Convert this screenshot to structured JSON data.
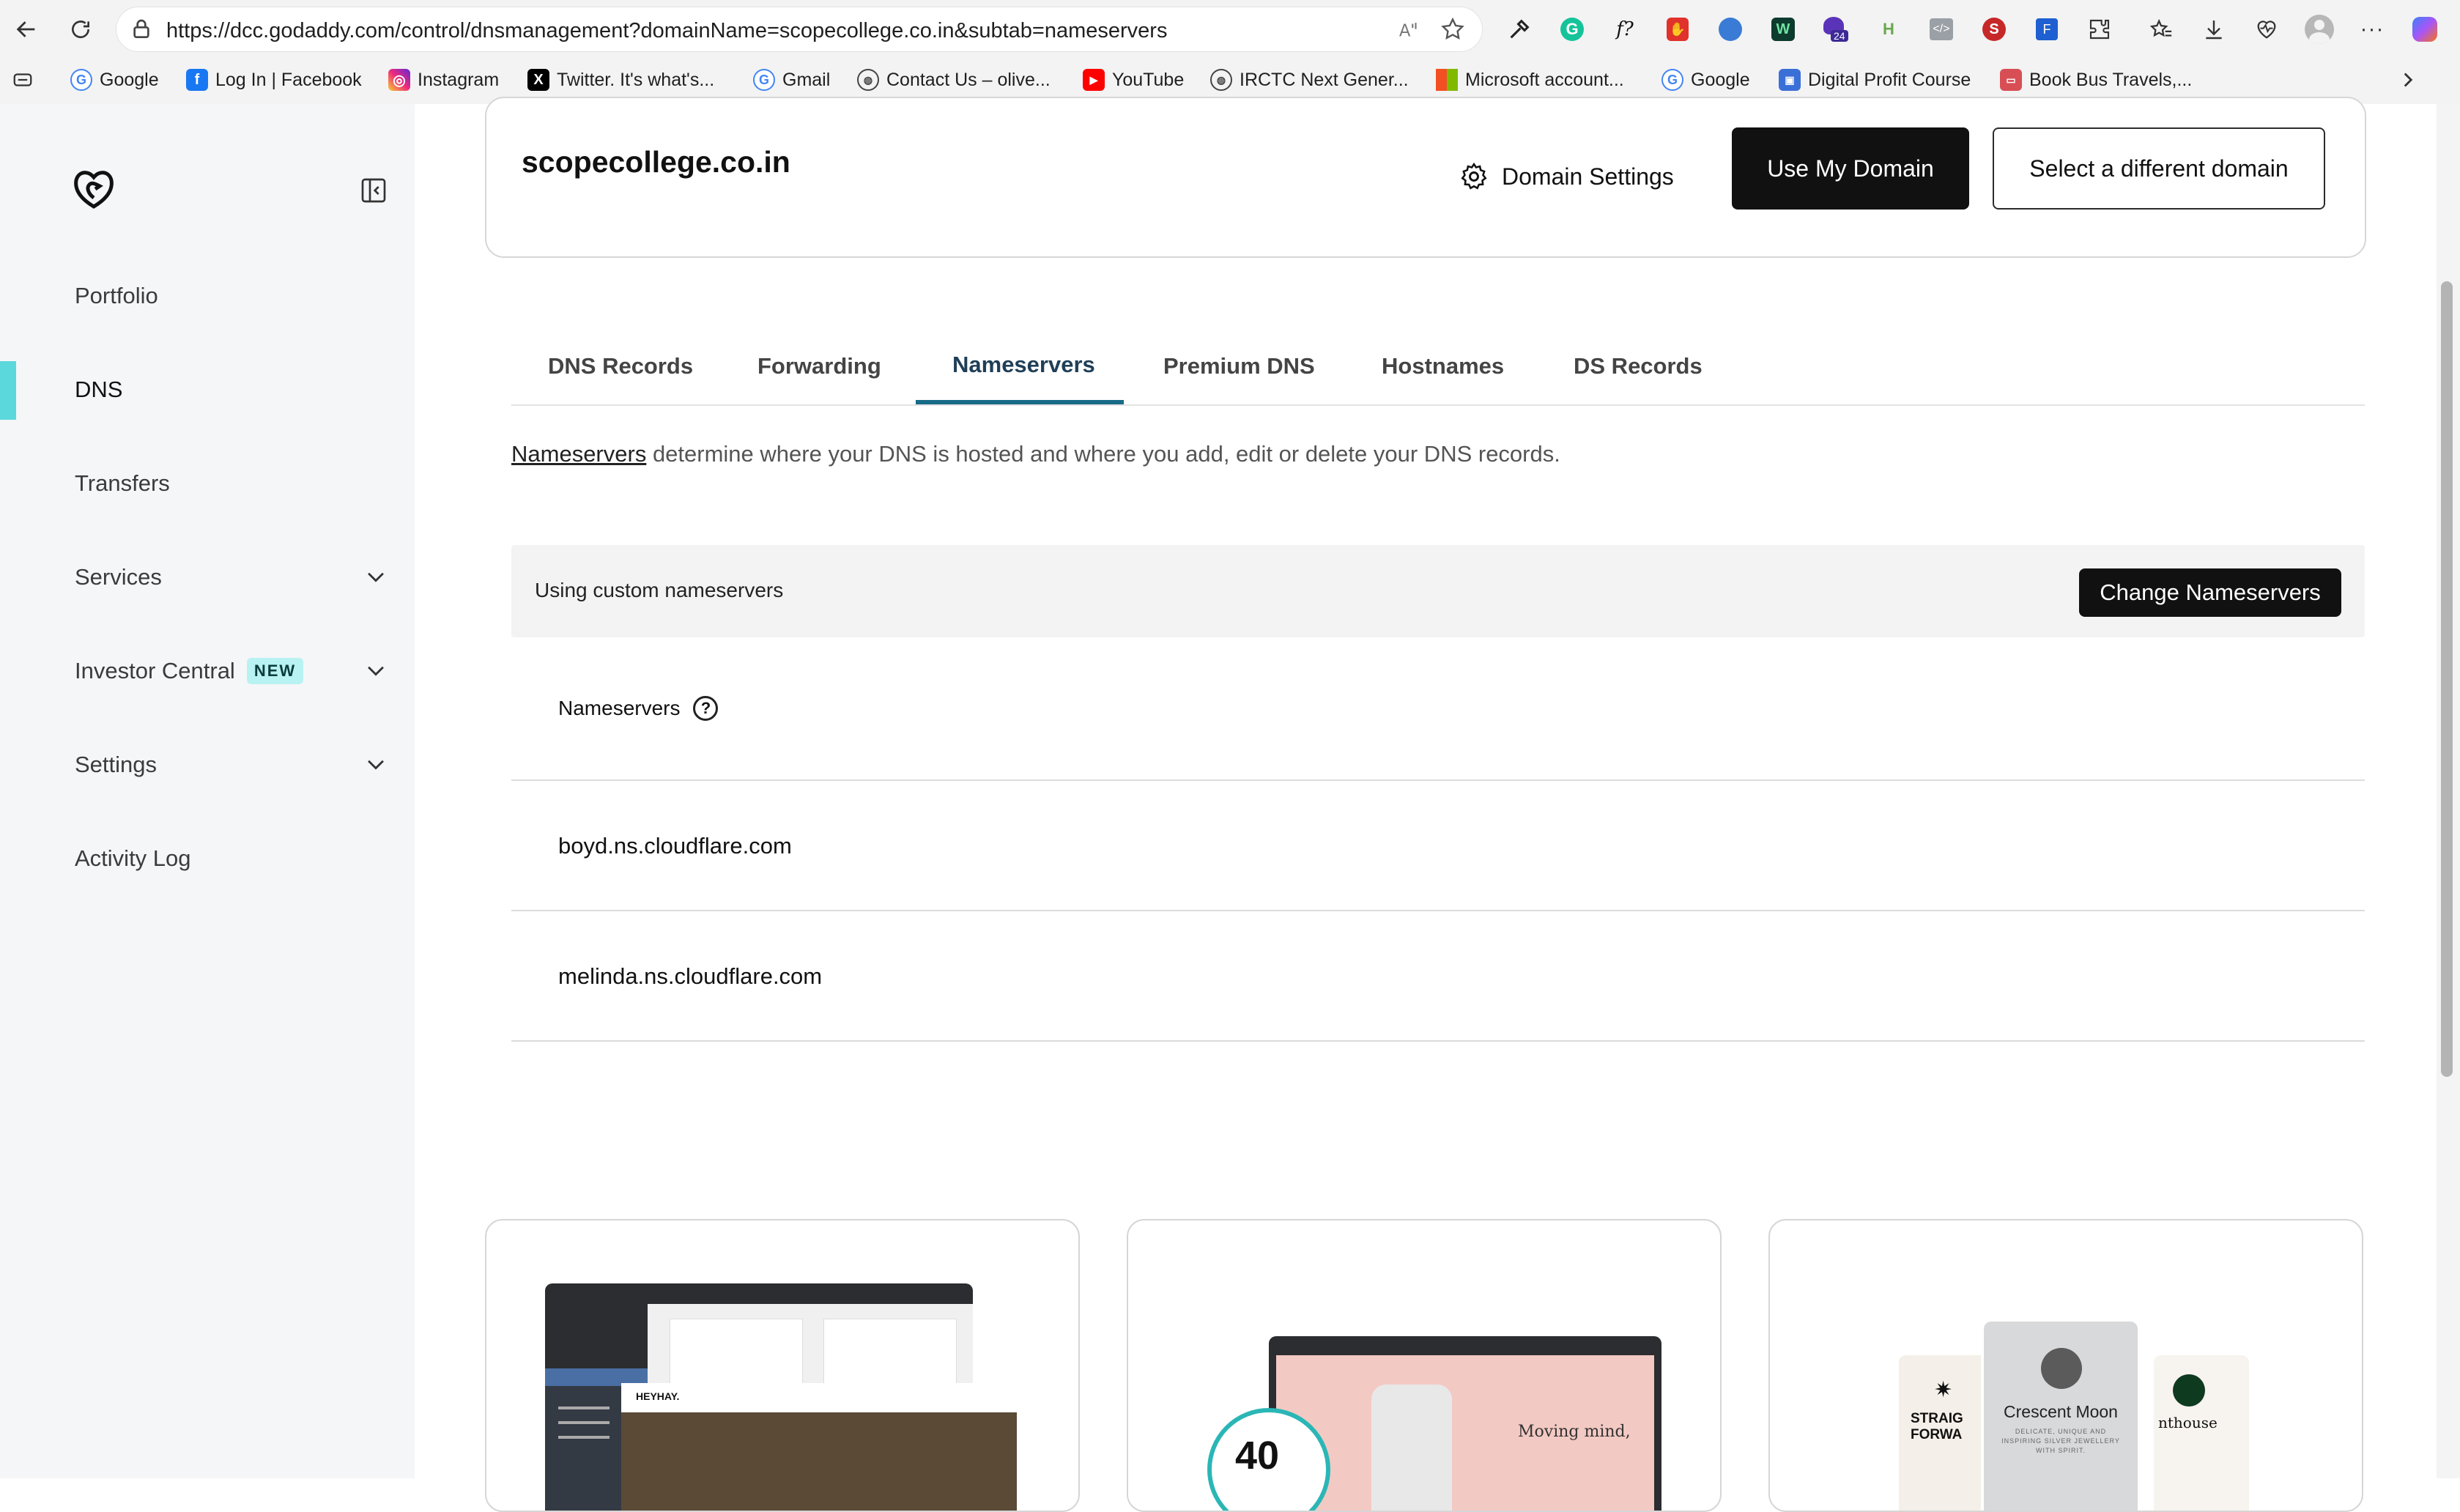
{
  "browser": {
    "url": "https://dcc.godaddy.com/control/dnsmanagement?domainName=scopecollege.co.in&subtab=nameservers",
    "extension_badge": "24",
    "bookmarks": [
      {
        "label": "Google",
        "icon": "google-icon",
        "color": "#4285f4"
      },
      {
        "label": "Log In | Facebook",
        "icon": "facebook-icon",
        "color": "#1877f2"
      },
      {
        "label": "Instagram",
        "icon": "instagram-icon",
        "color": "#d62976"
      },
      {
        "label": "Twitter. It's what's...",
        "icon": "x-icon",
        "color": "#000000"
      },
      {
        "label": "Gmail",
        "icon": "google-icon",
        "color": "#4285f4"
      },
      {
        "label": "Contact Us – olive...",
        "icon": "globe-icon",
        "color": "#555555"
      },
      {
        "label": "YouTube",
        "icon": "youtube-icon",
        "color": "#ff0000"
      },
      {
        "label": "IRCTC Next Gener...",
        "icon": "globe-icon",
        "color": "#555555"
      },
      {
        "label": "Microsoft account...",
        "icon": "microsoft-icon",
        "color": "#f25022"
      },
      {
        "label": "Google",
        "icon": "google-icon",
        "color": "#4285f4"
      },
      {
        "label": "Digital Profit Course",
        "icon": "course-icon",
        "color": "#3b6fd8"
      },
      {
        "label": "Book Bus Travels,...",
        "icon": "bus-icon",
        "color": "#d84e55"
      }
    ]
  },
  "sidebar": {
    "items": [
      {
        "label": "Portfolio"
      },
      {
        "label": "DNS"
      },
      {
        "label": "Transfers"
      },
      {
        "label": "Services"
      },
      {
        "label": "Investor Central",
        "badge": "NEW"
      },
      {
        "label": "Settings"
      },
      {
        "label": "Activity Log"
      }
    ],
    "accent": "#5ad8dc"
  },
  "domain_card": {
    "name": "scopecollege.co.in",
    "settings_label": "Domain Settings",
    "use_label": "Use My Domain",
    "select_label": "Select a different domain"
  },
  "tabs": [
    {
      "label": "DNS Records"
    },
    {
      "label": "Forwarding"
    },
    {
      "label": "Nameservers",
      "active": true
    },
    {
      "label": "Premium DNS"
    },
    {
      "label": "Hostnames"
    },
    {
      "label": "DS Records"
    }
  ],
  "intro": {
    "link": "Nameservers",
    "text": " determine where your DNS is hosted and where you add, edit or delete your DNS records."
  },
  "status": {
    "text": "Using custom nameservers",
    "change_label": "Change Nameservers"
  },
  "nameservers": {
    "header": "Nameservers",
    "help": "?",
    "list": [
      "boyd.ns.cloudflare.com",
      "melinda.ns.cloudflare.com"
    ]
  },
  "promos": [
    {
      "brand": "HEYHAY."
    },
    {
      "percent": "40",
      "tagline": "Moving mind,"
    },
    {
      "title": "Crescent Moon",
      "subtitle": "DELICATE, UNIQUE AND INSPIRING SILVER JEWELLERY WITH SPIRIT.",
      "left_text": "STRAIG FORWA",
      "right_text": "nthouse"
    }
  ]
}
